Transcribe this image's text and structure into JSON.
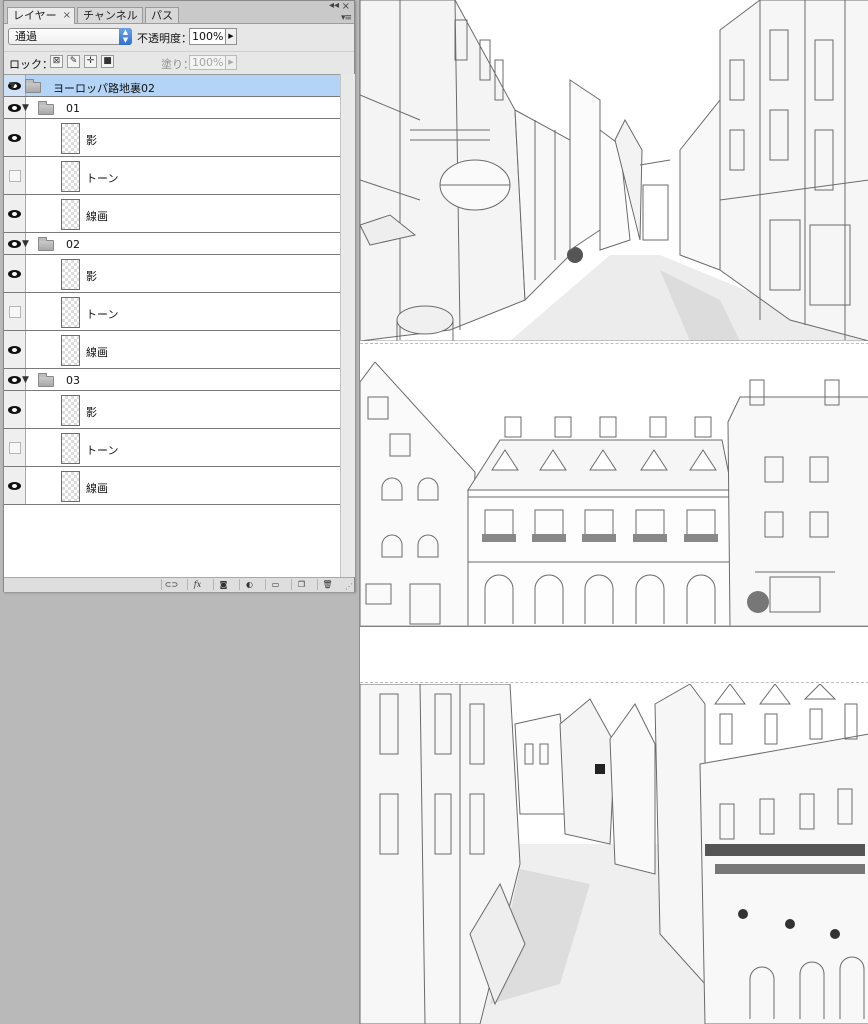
{
  "panel": {
    "tabs": [
      {
        "label": "レイヤー",
        "close": "×"
      },
      {
        "label": "チャンネル"
      },
      {
        "label": "パス"
      }
    ],
    "blend_mode": "通過",
    "opacity_label": "不透明度：",
    "opacity_value": "100%",
    "lock_label": "ロック：",
    "fill_label": "塗り：",
    "fill_value": "100%"
  },
  "layers": {
    "root_group": {
      "name": "ヨーロッパ路地裏02",
      "visible": true,
      "selected": true
    },
    "subgroups": [
      {
        "name": "01",
        "visible": true,
        "layers": [
          {
            "name": "影",
            "visible": true
          },
          {
            "name": "トーン",
            "visible": false
          },
          {
            "name": "線画",
            "visible": true
          }
        ]
      },
      {
        "name": "02",
        "visible": true,
        "layers": [
          {
            "name": "影",
            "visible": true
          },
          {
            "name": "トーン",
            "visible": false
          },
          {
            "name": "線画",
            "visible": true
          }
        ]
      },
      {
        "name": "03",
        "visible": true,
        "layers": [
          {
            "name": "影",
            "visible": true
          },
          {
            "name": "トーン",
            "visible": false
          },
          {
            "name": "線画",
            "visible": true
          }
        ]
      }
    ]
  },
  "bottom_buttons": [
    "link-icon",
    "fx-icon",
    "mask-icon",
    "adjustment-icon",
    "new-group-icon",
    "new-layer-icon",
    "trash-icon"
  ],
  "icons": {
    "fx": "fx",
    "menu": "▾≡",
    "close": "×"
  },
  "colors": {
    "selection": "#b3d4f7",
    "panel_bg": "#e7e7e7",
    "workspace": "#b9b9b9",
    "blend_arrow": "#2f6fd0"
  }
}
